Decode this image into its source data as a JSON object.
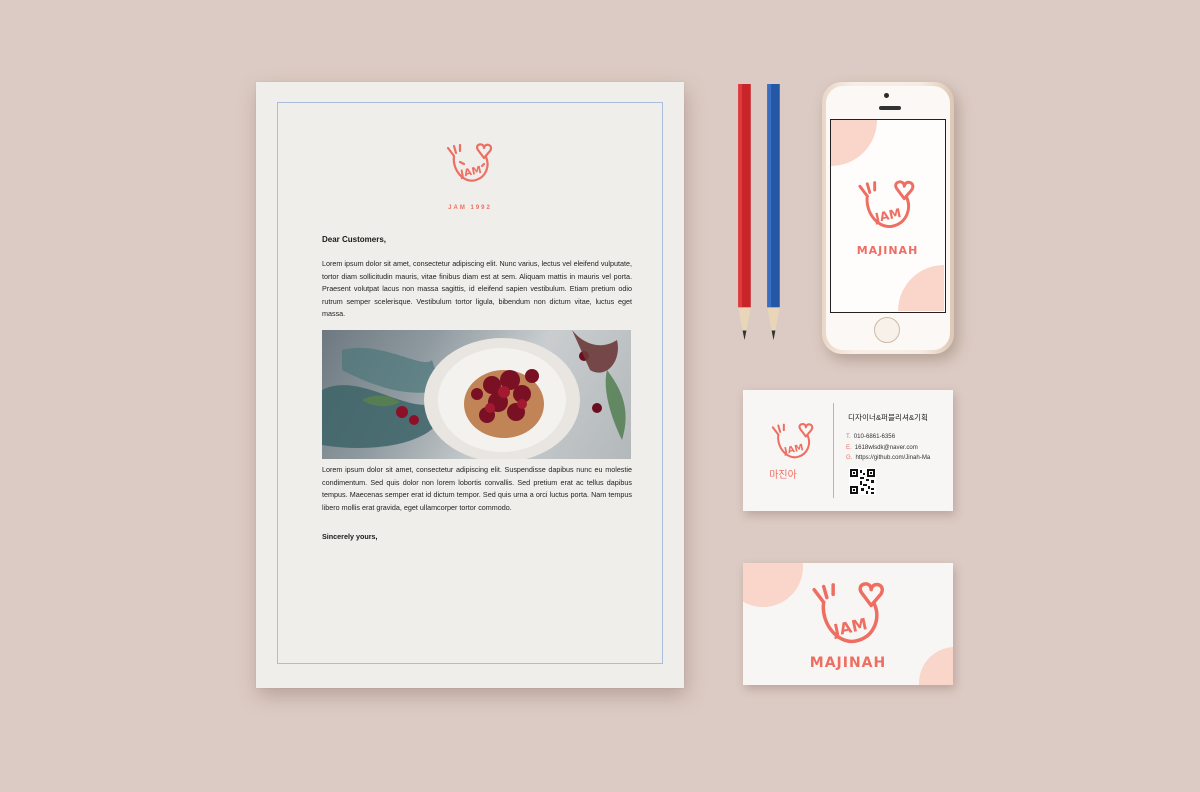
{
  "letter": {
    "tag": "JAM 1992",
    "greeting": "Dear Customers,",
    "paragraph1": "Lorem ipsum dolor sit amet, consectetur adipiscing elit. Nunc varius, lectus vel eleifend vulputate, tortor diam sollicitudin mauris, vitae finibus diam est at sem. Aliquam mattis in mauris vel porta. Praesent volutpat lacus non massa sagittis, id eleifend sapien vestibulum. Etiam pretium odio rutrum semper scelerisque. Vestibulum tortor ligula, bibendum non dictum vitae, luctus eget massa.",
    "paragraph2": "Lorem ipsum dolor sit amet, consectetur adipiscing elit. Suspendisse dapibus nunc eu molestie condimentum. Sed quis dolor non lorem lobortis convallis. Sed pretium erat ac tellus dapibus tempus. Maecenas semper erat id dictum tempor.  Sed quis urna a orci luctus porta. Nam tempus libero mollis erat gravida, eget ullamcorper tortor commodo.",
    "signoff": "Sincerely yours,"
  },
  "brand": {
    "logo_text": "JAM",
    "wordmark": "MAJINAH",
    "accent_color": "#ee6e62",
    "soft_color": "#f9d6c9"
  },
  "business_card": {
    "name": "마진아",
    "title": "디자이너&퍼블리셔&기획",
    "contacts": [
      {
        "key": "T.",
        "value": "010-6861-6356"
      },
      {
        "key": "E.",
        "value": "1618wlsdk@naver.com"
      },
      {
        "key": "G.",
        "value": "https://github.com/Jinah-Ma"
      }
    ]
  },
  "icons": {
    "brand_logo": "jam-smile-heart-logo",
    "qr": "qr-code-icon"
  }
}
